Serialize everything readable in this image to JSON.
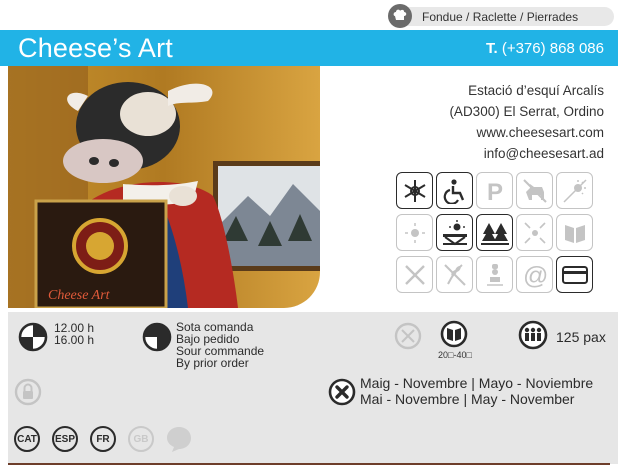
{
  "category": {
    "icon": "chef-hat-icon",
    "text": "Fondue / Raclette / Pierrades"
  },
  "header": {
    "title": "Cheese’s Art",
    "phone_prefix": "T.",
    "phone": "(+376) 868 086",
    "color": "#21b3e6"
  },
  "photo": {
    "caption_sign": "Cheese Art"
  },
  "address": {
    "line1": "Estació d’esquí Arcalís",
    "line2": "(AD300) El Serrat, Ordino",
    "web": "www.cheesesart.com",
    "email": "info@cheesesart.ad"
  },
  "amenities": [
    {
      "icon": "air-conditioning-icon",
      "active": true
    },
    {
      "icon": "wheelchair-icon",
      "active": true
    },
    {
      "icon": "parking-icon",
      "active": false
    },
    {
      "icon": "pets-allowed-icon",
      "active": false
    },
    {
      "icon": "sun-terrace-icon",
      "active": false
    },
    {
      "icon": "sun-rays-icon",
      "active": false
    },
    {
      "icon": "sun-terrace-table-icon",
      "active": true
    },
    {
      "icon": "mountain-trees-icon",
      "active": true
    },
    {
      "icon": "inward-arrows-icon",
      "active": false
    },
    {
      "icon": "menu-cutlery-icon",
      "active": false
    },
    {
      "icon": "no-cutlery-icon",
      "active": false
    },
    {
      "icon": "gluten-free-icon",
      "active": false
    },
    {
      "icon": "chef-icon",
      "active": false
    },
    {
      "icon": "at-sign-icon",
      "active": false
    },
    {
      "icon": "credit-card-icon",
      "active": true
    }
  ],
  "hours": {
    "open": "12.00 h",
    "close": "16.00 h"
  },
  "order": {
    "l1": "Sota comanda",
    "l2": "Bajo pedido",
    "l3": "Sour commande",
    "l4": "By prior order"
  },
  "menu_price": {
    "range": "20□-40□"
  },
  "capacity": {
    "text": "125 pax"
  },
  "closed": {
    "line1": "Maig - Novembre | Mayo - Noviembre",
    "line2": "Mai - Novembre | May - November"
  },
  "languages": [
    {
      "code": "CAT",
      "active": true
    },
    {
      "code": "ESP",
      "active": true
    },
    {
      "code": "FR",
      "active": true
    },
    {
      "code": "GB",
      "active": false
    }
  ]
}
